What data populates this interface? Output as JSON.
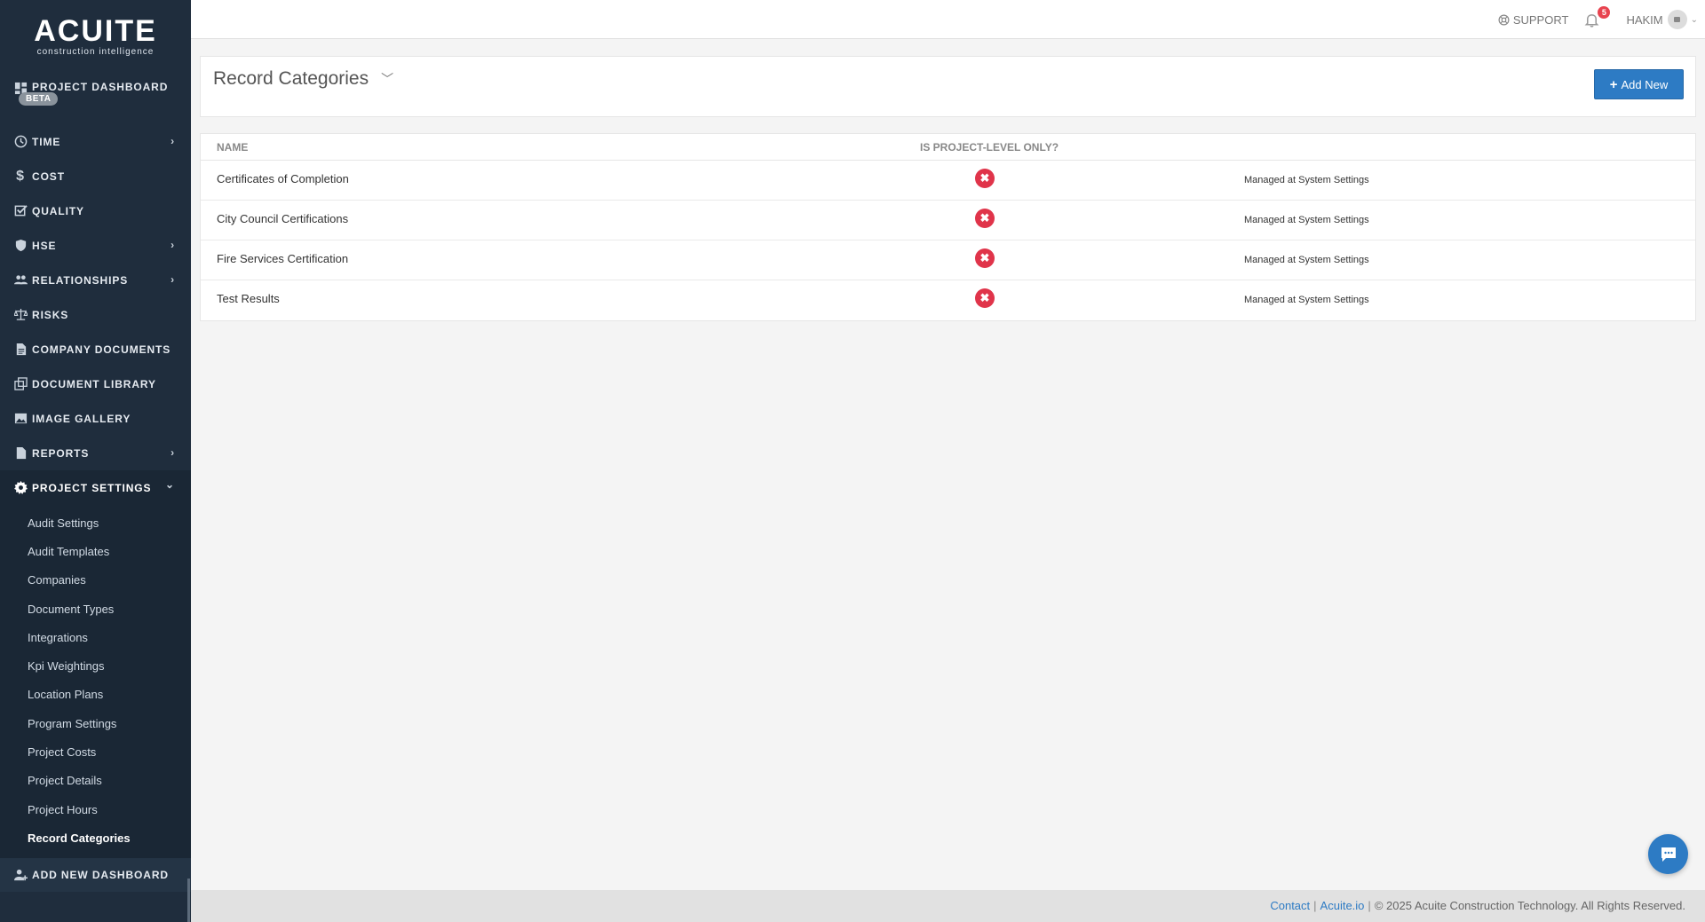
{
  "brand": {
    "logo": "ACUITE",
    "tagline": "construction intelligence"
  },
  "sidebar": {
    "items": [
      {
        "label": "PROJECT DASHBOARD",
        "icon": "dashboard-icon",
        "badge": "BETA"
      },
      {
        "label": "TIME",
        "icon": "clock-icon",
        "chevron": "›"
      },
      {
        "label": "COST",
        "icon": "dollar-icon"
      },
      {
        "label": "QUALITY",
        "icon": "checkbox-icon"
      },
      {
        "label": "HSE",
        "icon": "shield-icon",
        "chevron": "›"
      },
      {
        "label": "RELATIONSHIPS",
        "icon": "people-icon",
        "chevron": "›"
      },
      {
        "label": "RISKS",
        "icon": "scale-icon"
      },
      {
        "label": "COMPANY DOCUMENTS",
        "icon": "document-icon"
      },
      {
        "label": "DOCUMENT LIBRARY",
        "icon": "library-icon"
      },
      {
        "label": "IMAGE GALLERY",
        "icon": "image-icon"
      },
      {
        "label": "REPORTS",
        "icon": "report-icon",
        "chevron": "›"
      },
      {
        "label": "PROJECT SETTINGS",
        "icon": "gear-icon",
        "chevron": "⌄"
      }
    ],
    "settings_sub": [
      "Audit Settings",
      "Audit Templates",
      "Companies",
      "Document Types",
      "Integrations",
      "Kpi Weightings",
      "Location Plans",
      "Program Settings",
      "Project Costs",
      "Project Details",
      "Project Hours",
      "Record Categories"
    ],
    "add_dashboard": "ADD NEW DASHBOARD"
  },
  "topbar": {
    "support": "SUPPORT",
    "notifications": "5",
    "user": "HAKIM"
  },
  "page": {
    "title": "Record Categories",
    "add_button": "Add New"
  },
  "table": {
    "headers": {
      "name": "NAME",
      "project_level": "IS PROJECT-LEVEL ONLY?"
    },
    "rows": [
      {
        "name": "Certificates of Completion",
        "project_level": "✖",
        "note": "Managed at System Settings"
      },
      {
        "name": "City Council Certifications",
        "project_level": "✖",
        "note": "Managed at System Settings"
      },
      {
        "name": "Fire Services Certification",
        "project_level": "✖",
        "note": "Managed at System Settings"
      },
      {
        "name": "Test Results",
        "project_level": "✖",
        "note": "Managed at System Settings"
      }
    ]
  },
  "footer": {
    "contact": "Contact",
    "site": "Acuite.io",
    "copyright": "© 2025 Acuite Construction Technology. All Rights Reserved."
  },
  "colors": {
    "sidebar": "#1f2d3d",
    "accent": "#2d7bc4",
    "danger": "#e0344a"
  }
}
